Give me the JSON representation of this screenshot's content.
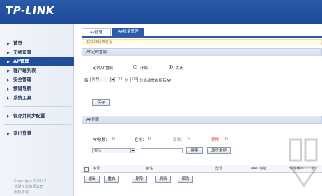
{
  "header": {
    "logo": "TP-LINK"
  },
  "sidebar": {
    "items": [
      {
        "label": "首页"
      },
      {
        "label": "无线设置"
      },
      {
        "label": "AP管理"
      },
      {
        "label": "客户端列表"
      },
      {
        "label": "安全管理"
      },
      {
        "label": "频谱导航"
      },
      {
        "label": "系统工具"
      },
      {
        "label": "保存并同步配置"
      },
      {
        "label": "退出登录"
      }
    ],
    "active_index": 2,
    "copyright": [
      "Copyright ©2017",
      "普联技术有限公司",
      "版权所有"
    ]
  },
  "tabs": [
    {
      "label": "AP管理"
    },
    {
      "label": "AP批量管理"
    }
  ],
  "notice": "获取AP列表成功",
  "reboot_panel": {
    "title": "AP定时重启",
    "label": "定时AP重启：",
    "option_on": "开启",
    "option_off": "关闭",
    "selected": "关闭",
    "every": "每",
    "day_value": "周日",
    "hour_value": "03",
    "hour_unit": "时",
    "minute_value": "09",
    "minute_suffix": "分自动重启所有AP",
    "save_label": "保存"
  },
  "ap_list": {
    "title": "AP列表",
    "stats": [
      {
        "label": "AP总数：",
        "value": "0"
      },
      {
        "label": "在线：",
        "value": "0"
      },
      {
        "label": "离线：",
        "value": "0"
      },
      {
        "label": "异常：",
        "value": "0"
      }
    ],
    "filter_value": "备注",
    "filter_colon": ":",
    "search_label": "搜索",
    "show_all_label": "显示全部",
    "columns": [
      "序号",
      "备注",
      "型号",
      "MAC地址",
      "软件版本",
      "状"
    ]
  },
  "actions": [
    "编辑",
    "重启",
    "删除",
    "刷新",
    "帮助"
  ],
  "colors": {
    "header": "#1f4e9e",
    "active": "#1f4e9e",
    "alert": "#d23a2a"
  },
  "icons": {
    "sidebar_arrow": "triangle-right-icon",
    "watermark": "download-logo-icon"
  }
}
